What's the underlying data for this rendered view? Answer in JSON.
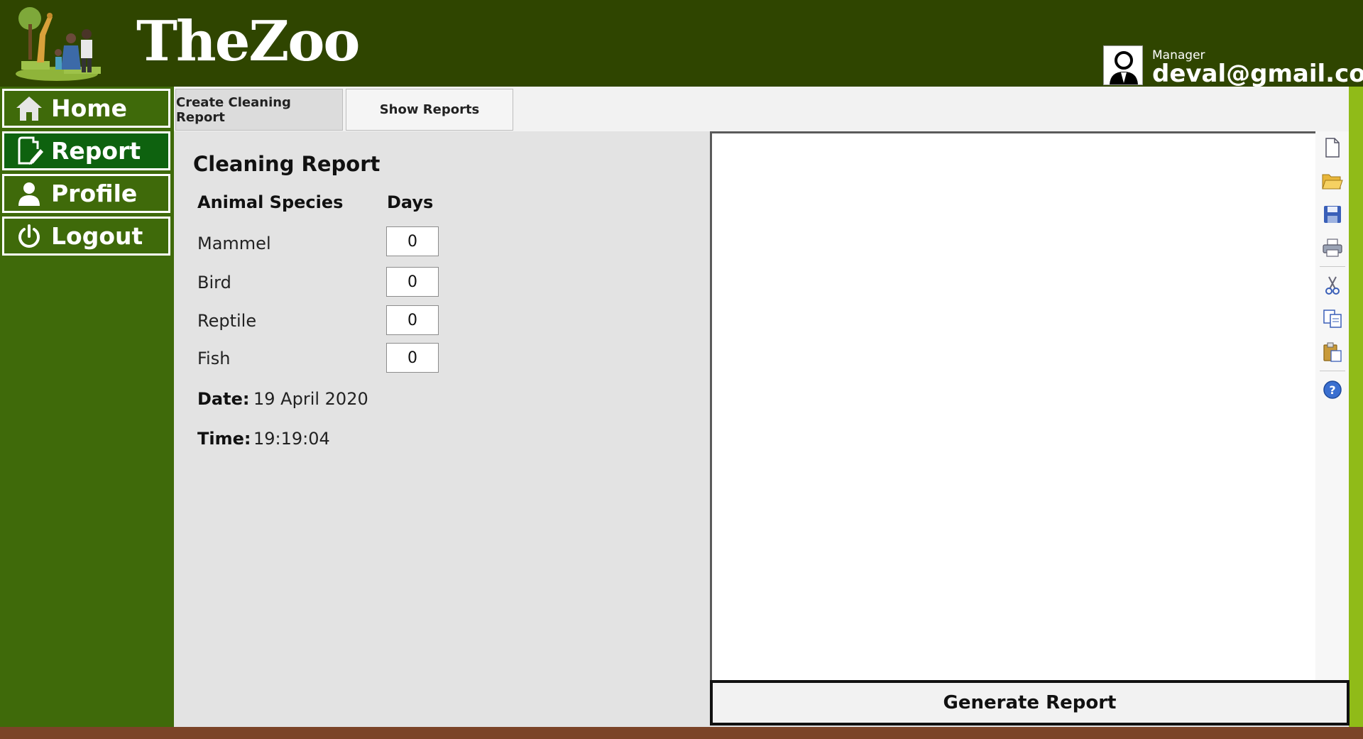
{
  "brand": {
    "logo_text": "TheZoo"
  },
  "user": {
    "role": "Manager",
    "email": "deval@gmail.com"
  },
  "sidebar": {
    "items": [
      {
        "label": "Home",
        "icon": "home-icon"
      },
      {
        "label": "Report",
        "icon": "edit-document-icon",
        "active": true
      },
      {
        "label": "Profile",
        "icon": "user-icon"
      },
      {
        "label": "Logout",
        "icon": "power-icon"
      }
    ]
  },
  "tabs": [
    {
      "label": "Create Cleaning Report",
      "active": true
    },
    {
      "label": "Show Reports",
      "active": false
    }
  ],
  "form": {
    "title": "Cleaning Report",
    "col_species": "Animal Species",
    "col_days": "Days",
    "rows": [
      {
        "species": "Mammel",
        "days": "0"
      },
      {
        "species": "Bird",
        "days": "0"
      },
      {
        "species": "Reptile",
        "days": "0"
      },
      {
        "species": "Fish",
        "days": "0"
      }
    ],
    "date_label": "Date:",
    "date_value": "19 April 2020",
    "time_label": "Time:",
    "time_value": "19:19:04"
  },
  "toolbar": [
    "new-document-icon",
    "open-folder-icon",
    "save-icon",
    "print-icon",
    "cut-icon",
    "copy-icon",
    "paste-icon",
    "help-icon"
  ],
  "actions": {
    "generate_label": "Generate Report"
  },
  "colors": {
    "header": "#2f4500",
    "sidebar": "#3f6a0a",
    "active_nav": "#0e620f",
    "accent_stripe": "#90bb18",
    "footer": "#7b4428"
  }
}
